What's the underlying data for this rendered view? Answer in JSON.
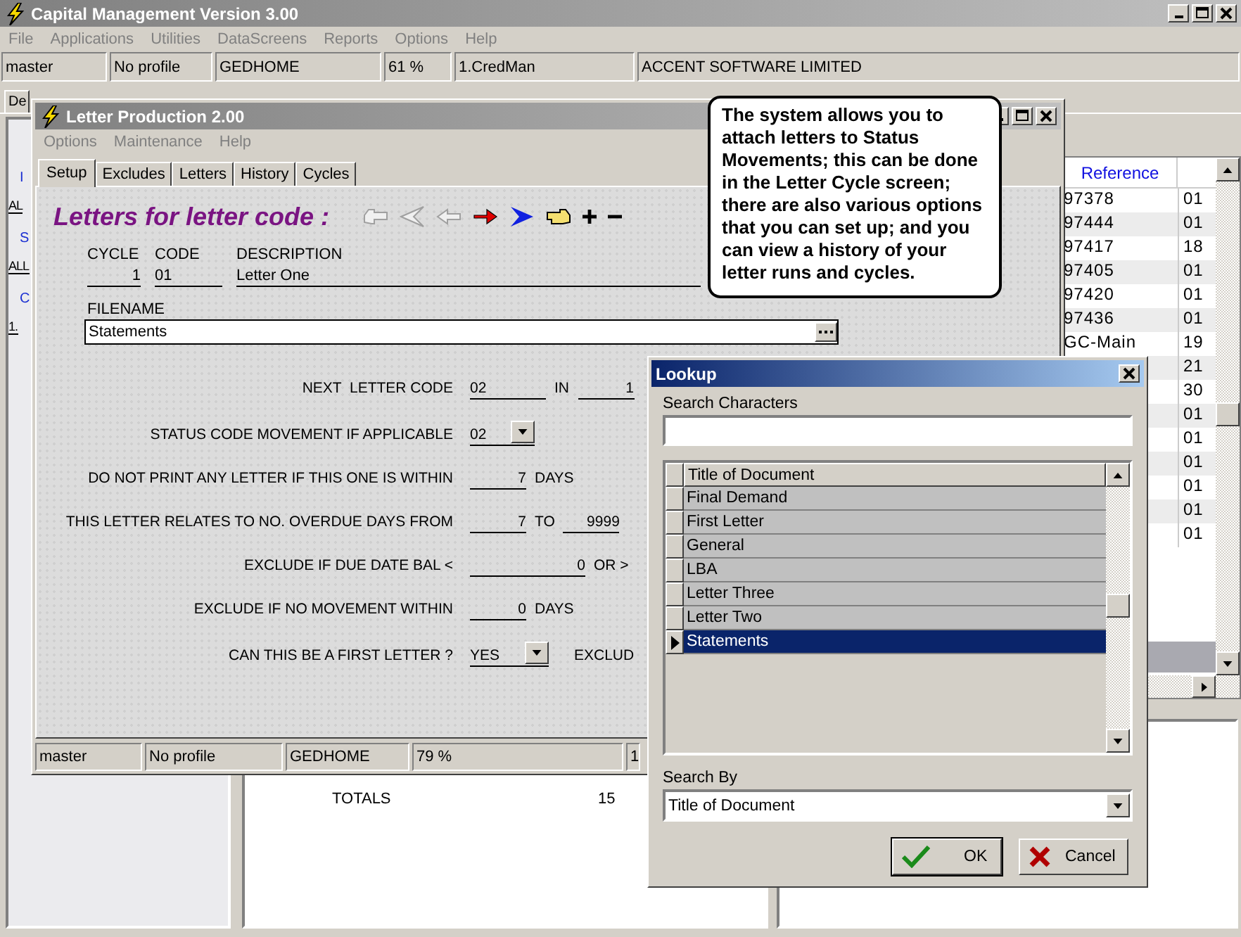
{
  "window": {
    "title": "Capital Management Version 3.00"
  },
  "menu": [
    "File",
    "Applications",
    "Utilities",
    "DataScreens",
    "Reports",
    "Options",
    "Help"
  ],
  "status_fields": [
    "master",
    "No profile",
    "GEDHOME",
    "61 %",
    "1.CredMan",
    "ACCENT SOFTWARE LIMITED"
  ],
  "tabs": [
    {
      "label": "De",
      "selected": false
    }
  ],
  "left_panel": [
    {
      "kind": "heading",
      "text": "I"
    },
    {
      "kind": "value",
      "text": "AL"
    },
    {
      "kind": "heading",
      "text": "S"
    },
    {
      "kind": "value",
      "text": "ALL"
    },
    {
      "kind": "heading",
      "text": "C"
    },
    {
      "kind": "value",
      "text": "1."
    }
  ],
  "reference_table": {
    "columns": [
      "Reference"
    ],
    "rows": [
      {
        "reference": "97378",
        "column_2": "01"
      },
      {
        "reference": "97444",
        "column_2": "01"
      },
      {
        "reference": "97417",
        "column_2": "18"
      },
      {
        "reference": "97405",
        "column_2": "01"
      },
      {
        "reference": "97420",
        "column_2": "01"
      },
      {
        "reference": "97436",
        "column_2": "01"
      },
      {
        "reference": "GC-Main",
        "column_2": "19"
      },
      {
        "column_2": "21"
      },
      {
        "column_2": "30"
      },
      {
        "column_2": "01"
      },
      {
        "column_2": "01"
      },
      {
        "column_2": "01"
      },
      {
        "column_2": "01"
      },
      {
        "column_2": "01"
      },
      {
        "column_2": "01"
      }
    ]
  },
  "totals": {
    "label": "TOTALS",
    "value": "15"
  },
  "letter_window": {
    "title": "Letter Production 2.00",
    "menu": [
      "Options",
      "Maintenance",
      "Help"
    ],
    "tabs": [
      {
        "label": "Setup",
        "selected": true
      },
      {
        "label": "Excludes",
        "selected": false
      },
      {
        "label": "Letters",
        "selected": false
      },
      {
        "label": "History",
        "selected": false
      },
      {
        "label": "Cycles",
        "selected": false
      }
    ],
    "heading": "Letters for letter code :",
    "columns": [
      "CYCLE",
      "CODE",
      "DESCRIPTION"
    ],
    "values": [
      "1",
      "01",
      "Letter One"
    ],
    "filename_label": "FILENAME",
    "filename": "Statements",
    "rows": [
      {
        "label": "NEXT  LETTER CODE",
        "items": [
          {
            "kind": "field",
            "value": "02"
          },
          {
            "kind": "label",
            "text": "IN"
          },
          {
            "kind": "number",
            "value": "1"
          }
        ]
      },
      {
        "label": "STATUS CODE MOVEMENT IF APPLICABLE",
        "items": [
          {
            "kind": "dropdown",
            "value": "02"
          }
        ]
      },
      {
        "label": "DO NOT PRINT ANY LETTER IF THIS ONE IS WITHIN",
        "items": [
          {
            "kind": "number",
            "value": "7"
          },
          {
            "kind": "label",
            "text": "DAYS"
          }
        ]
      },
      {
        "label": "THIS LETTER RELATES TO NO. OVERDUE DAYS FROM",
        "items": [
          {
            "kind": "number",
            "value": "7"
          },
          {
            "kind": "label",
            "text": "TO"
          },
          {
            "kind": "number",
            "value": "9999"
          }
        ]
      },
      {
        "label": "EXCLUDE IF DUE DATE BAL <",
        "items": [
          {
            "kind": "wide",
            "value": "0"
          },
          {
            "kind": "label",
            "text": "OR >"
          }
        ]
      },
      {
        "label": "EXCLUDE IF NO MOVEMENT WITHIN",
        "items": [
          {
            "kind": "number",
            "value": "0"
          },
          {
            "kind": "label",
            "text": "DAYS"
          }
        ]
      },
      {
        "label": "CAN THIS BE A FIRST LETTER ?",
        "items": [
          {
            "kind": "dropdown",
            "value": "YES"
          },
          {
            "kind": "label",
            "text": "EXCLUD"
          }
        ]
      }
    ],
    "status_fields": [
      "master",
      "No profile",
      "GEDHOME",
      "79 %",
      "1"
    ]
  },
  "tooltip": "The system allows you to attach letters to Status Movements; this can be done in the Letter Cycle screen; there are also various options that you can set up; and you can view a history of your letter runs and cycles.",
  "lookup": {
    "title": "Lookup",
    "search_label": "Search Characters",
    "column": "Title of Document",
    "rows": [
      {
        "title": "Final Demand",
        "selected": false
      },
      {
        "title": "First Letter",
        "selected": false
      },
      {
        "title": "General",
        "selected": false
      },
      {
        "title": "LBA",
        "selected": false
      },
      {
        "title": "Letter Three",
        "selected": false
      },
      {
        "title": "Letter Two",
        "selected": false
      },
      {
        "title": "Statements",
        "selected": true
      }
    ],
    "search_by_label": "Search By",
    "search_by": "Title of Document",
    "buttons": [
      {
        "kind": "ok",
        "label": "OK"
      },
      {
        "kind": "cancel",
        "label": "Cancel"
      }
    ]
  }
}
